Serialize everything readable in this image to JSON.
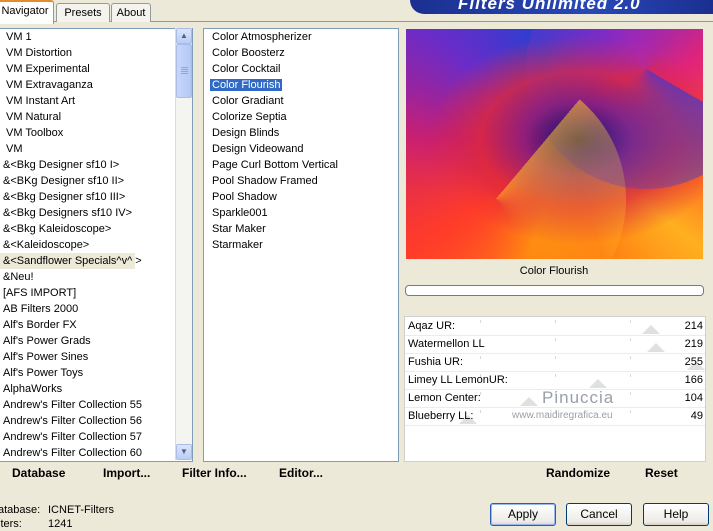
{
  "tabs": [
    "Navigator",
    "Presets",
    "About"
  ],
  "banner": "Filters Unlimited 2.0",
  "categories": [
    "VM 1",
    "VM Distortion",
    "VM Experimental",
    "VM Extravaganza",
    "VM Instant Art",
    "VM Natural",
    "VM Toolbox",
    "VM",
    "&<Bkg Designer sf10 I>",
    "&<BKg Designer sf10 II>",
    "&<Bkg Designer sf10 III>",
    "&<Bkg Designers sf10 IV>",
    "&<Bkg Kaleidoscope>",
    "&<Kaleidoscope>",
    "&<Sandflower Specials^v^ >",
    "&Neu!",
    "[AFS IMPORT]",
    "AB Filters 2000",
    "Alf's Border FX",
    "Alf's Power Grads",
    "Alf's Power Sines",
    "Alf's Power Toys",
    "AlphaWorks",
    "Andrew's Filter Collection 55",
    "Andrew's Filter Collection 56",
    "Andrew's Filter Collection 57",
    "Andrew's Filter Collection 60"
  ],
  "selected_category": "&<Sandflower Specials^v^ >",
  "filters": [
    "Color Atmospherizer",
    "Color Boosterz",
    "Color Cocktail",
    "Color Flourish",
    "Color Gradiant",
    "Colorize Septia",
    "Design Blinds",
    "Design Videowand",
    "Page Curl Bottom Vertical",
    "Pool Shadow Framed",
    "Pool Shadow",
    "Sparkle001",
    "Star Maker",
    "Starmaker"
  ],
  "selected_filter": "Color Flourish",
  "preview_title": "Color Flourish",
  "parameters": [
    {
      "name": "Aqaz UR:",
      "value": "214"
    },
    {
      "name": "Watermellon LL",
      "value": "219"
    },
    {
      "name": "Fushia UR:",
      "value": "255"
    },
    {
      "name": "Limey LL LemonUR:",
      "value": "166"
    },
    {
      "name": "Lemon Center:",
      "value": "104"
    },
    {
      "name": "Blueberry LL:",
      "value": "49"
    }
  ],
  "watermark": {
    "line1": "Pinuccia",
    "line2": "www.maidiregrafica.eu"
  },
  "bottom_links": {
    "database": "Database",
    "import": "Import...",
    "filter_info": "Filter Info...",
    "editor": "Editor...",
    "randomize": "Randomize",
    "reset": "Reset"
  },
  "info": {
    "database_label": "atabase:",
    "database_value": "ICNET-Filters",
    "filters_label": "lters:",
    "filters_value": "1241"
  },
  "buttons": {
    "apply": "Apply",
    "cancel": "Cancel",
    "help": "Help"
  }
}
